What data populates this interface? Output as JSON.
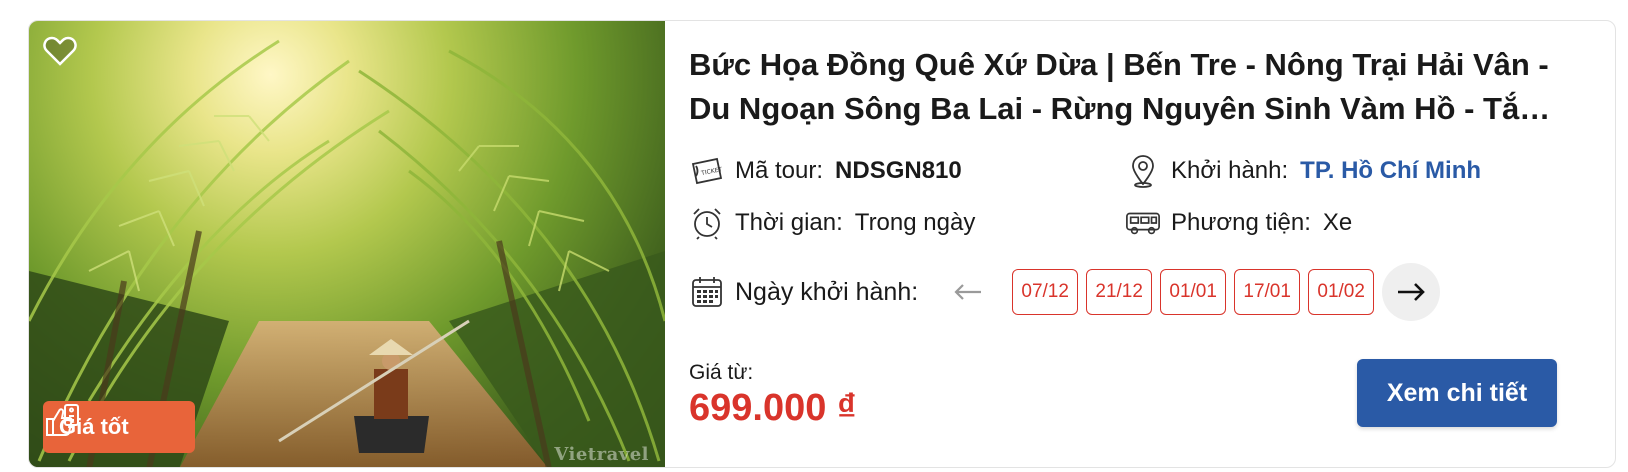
{
  "tour": {
    "title": "Bức Họa Đồng Quê Xứ Dừa | Bến Tre - Nông Trại Hải Vân - Du Ngoạn Sông Ba Lai - Rừng Nguyên Sinh Vàm Hồ - Tắm Bùn",
    "badge_label": "Giá tốt",
    "watermark": "Vietravel",
    "code_label": "Mã tour:",
    "code_value": "NDSGN810",
    "departure_label": "Khởi hành:",
    "departure_value": "TP. Hồ Chí Minh",
    "duration_label": "Thời gian:",
    "duration_value": "Trong ngày",
    "transport_label": "Phương tiện:",
    "transport_value": "Xe",
    "dates_label": "Ngày khởi hành:",
    "dates": [
      "07/12",
      "21/12",
      "01/01",
      "17/01",
      "01/02"
    ],
    "price_label": "Giá từ:",
    "price_value": "699.000 ₫",
    "cta_label": "Xem chi tiết"
  },
  "icons": {
    "wishlist": "heart-icon",
    "badge": "thumbs-up-price-tag-icon",
    "code": "ticket-icon",
    "departure": "map-pin-icon",
    "duration": "alarm-clock-icon",
    "transport": "bus-icon",
    "dates": "calendar-icon",
    "prev": "arrow-left-icon",
    "next": "arrow-right-icon"
  },
  "colors": {
    "accent_red": "#d9342b",
    "badge_orange": "#e8643a",
    "brand_blue": "#2a5aa6"
  }
}
